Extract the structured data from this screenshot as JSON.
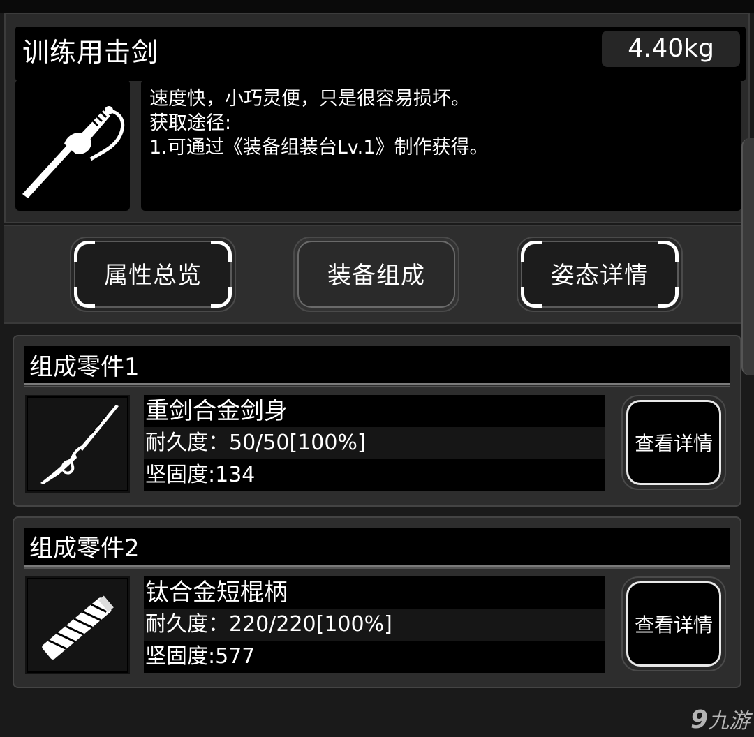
{
  "item": {
    "name": "训练用击剑",
    "weight": "4.40kg",
    "description": [
      "速度快，小巧灵便，只是很容易损坏。",
      "获取途径:",
      "1.可通过《装备组装台Lv.1》制作获得。"
    ],
    "icon": "fencing-sabre-icon"
  },
  "tabs": [
    {
      "label": "属性总览",
      "active": false
    },
    {
      "label": "装备组成",
      "active": true
    },
    {
      "label": "姿态详情",
      "active": false
    }
  ],
  "parts": [
    {
      "header": "组成零件1",
      "name": "重剑合金剑身",
      "durability": "耐久度：50/50[100%]",
      "toughness": "坚固度:134",
      "button": "查看详情",
      "icon": "sword-blade-icon"
    },
    {
      "header": "组成零件2",
      "name": "钛合金短棍柄",
      "durability": "耐久度：220/220[100%]",
      "toughness": "坚固度:577",
      "button": "查看详情",
      "icon": "short-handle-icon"
    }
  ],
  "watermark": {
    "mark": "9",
    "text": "九游"
  }
}
